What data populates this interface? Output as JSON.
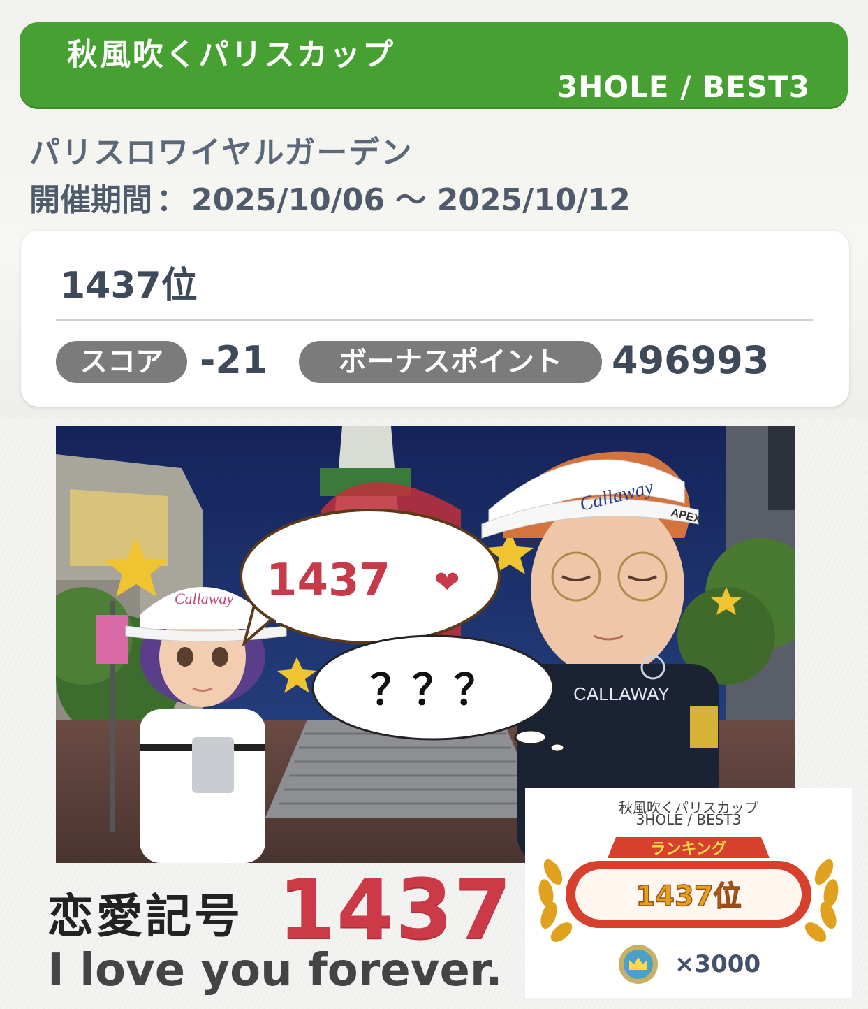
{
  "header": {
    "cup_name": "秋風吹くパリスカップ",
    "format": "3HOLE / BEST3"
  },
  "course": {
    "name": "パリスロワイヤルガーデン",
    "period_label": "開催期間",
    "period_separator": "：",
    "period_value": "2025/10/06 ～ 2025/10/12"
  },
  "result": {
    "rank": "1437位",
    "score_label": "スコア",
    "score_value": "-21",
    "bonus_label": "ボーナスポイント",
    "bonus_value": "496993"
  },
  "scene": {
    "speech_bubble": "1437",
    "heart": "❤",
    "thought_bubble": "？？？",
    "visor_brand_left": "Callaway",
    "visor_brand_right": "Callaway",
    "visor_tag": "APEX",
    "shirt_brand": "CALLAWAY"
  },
  "caption": {
    "symbol_label": "恋愛記号",
    "number": "1437",
    "message": "I love you forever."
  },
  "reward": {
    "cup_name": "秋風吹くパリスカップ",
    "format": "3HOLE / BEST3",
    "ranking_label": "ランキング",
    "rank": "1437位",
    "coins": "×3000"
  },
  "colors": {
    "header_green": "#47a132",
    "love_red": "#cc3a48",
    "ranking_red": "#d8402e",
    "pill_gray": "#7b7b7b"
  }
}
